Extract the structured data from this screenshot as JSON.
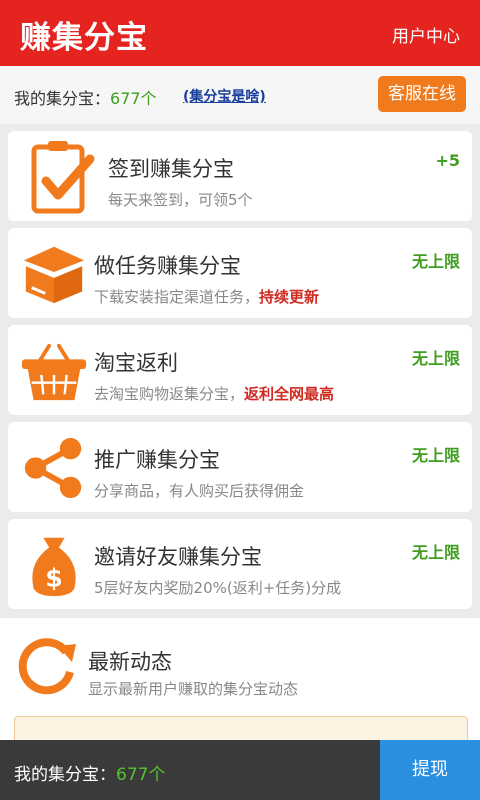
{
  "header": {
    "title": "赚集分宝",
    "user_center": "用户中心"
  },
  "balance": {
    "label": "我的集分宝：",
    "value": "677个",
    "what_link": "(集分宝是啥)",
    "service_button": "客服在线"
  },
  "cards": [
    {
      "title": "签到赚集分宝",
      "subtitle": "每天来签到，可领5个",
      "highlight": "",
      "reward": "+5",
      "icon": "clipboard-check-icon"
    },
    {
      "title": "做任务赚集分宝",
      "subtitle": "下载安装指定渠道任务，",
      "highlight": "持续更新",
      "reward": "无上限",
      "icon": "open-box-icon"
    },
    {
      "title": "淘宝返利",
      "subtitle": "去淘宝购物返集分宝，",
      "highlight": "返利全网最高",
      "reward": "无上限",
      "icon": "shopping-basket-icon"
    },
    {
      "title": "推广赚集分宝",
      "subtitle": "分享商品，有人购买后获得佣金",
      "highlight": "",
      "reward": "无上限",
      "icon": "share-icon"
    },
    {
      "title": "邀请好友赚集分宝",
      "subtitle": "5层好友内奖励20%(返利+任务)分成",
      "highlight": "",
      "reward": "无上限",
      "icon": "money-bag-icon"
    }
  ],
  "news": {
    "title": "最新动态",
    "subtitle": "显示最新用户赚取的集分宝动态"
  },
  "footer": {
    "label": "我的集分宝：",
    "value": "677个",
    "withdraw": "提现"
  },
  "colors": {
    "header_red": "#e5241f",
    "accent_orange": "#f07a1c",
    "reward_green": "#3e9e1f",
    "highlight_red": "#d02b22",
    "withdraw_blue": "#2b8fe0"
  }
}
